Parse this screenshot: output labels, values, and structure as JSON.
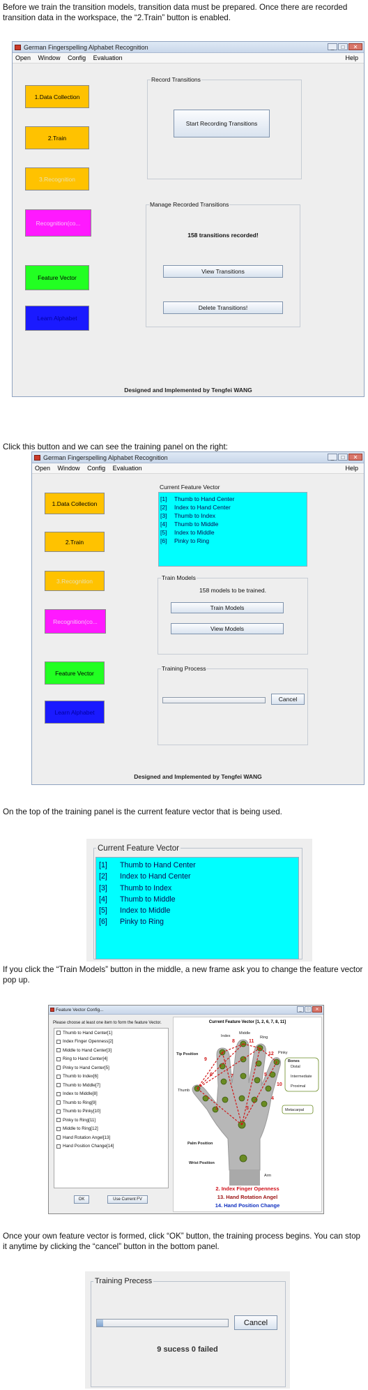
{
  "intro": {
    "text": "Before we train the transition models, transition data must be prepared. Once there are recorded transition data in the workspace, the “2.Train” button is enabled."
  },
  "app": {
    "title": "German Fingerspelling Alphabet Recognition",
    "menu": [
      "Open",
      "Window",
      "Config",
      "Evaluation"
    ],
    "help": "Help",
    "side_buttons": [
      "1.Data Collection",
      "2.Train",
      "3.Recognition",
      "Recognition(co...",
      "Feature Vector",
      "Learn Alphabet"
    ],
    "footer": "Designed and Implemented by Tengfei WANG"
  },
  "window1": {
    "record_title": "Record Transitions",
    "start_button": "Start Recording Transitions",
    "manage_title": "Manage Recorded Transitions",
    "count_text": "158  transitions recorded!",
    "view_button": "View Transitions",
    "delete_button": "Delete Transitions!"
  },
  "text2": "Click this button and we can see the training panel on the right:",
  "window2": {
    "fv_title": "Current Feature Vector",
    "fv_items": [
      {
        "n": "[1]",
        "label": "Thumb to Hand Center"
      },
      {
        "n": "[2]",
        "label": "Index to Hand Center"
      },
      {
        "n": "[3]",
        "label": "Thumb to Index"
      },
      {
        "n": "[4]",
        "label": "Thumb to Middle"
      },
      {
        "n": "[5]",
        "label": "Index to Middle"
      },
      {
        "n": "[6]",
        "label": "Pinky to Ring"
      }
    ],
    "train_title": "Train Models",
    "models_text": "158  models to be trained.",
    "train_button": "Train Models",
    "view_models_button": "View Models",
    "process_title": "Training Process",
    "cancel_button": "Cancel"
  },
  "text3": "On the top of the training panel is the current feature vector that is being used.",
  "zoom_fv": {
    "title": "Current Feature Vector"
  },
  "text4": "If you click the “Train Models” button in the middle, a new frame ask you to change the feature vector pop up.",
  "fv_frame": {
    "title": "Feature Vector Config...",
    "instruction": "Please choose at least one item to form the feature Vector.",
    "items": [
      "Thumb to Hand Center[1]",
      "Index Finger Openness[2]",
      "Middle to Hand Center[3]",
      "Ring to Hand Center[4]",
      "Pinky to Hand Center[5]",
      "Thumb to Index[6]",
      "Thumb to Middle[7]",
      "Index to Middle[8]",
      "Thumb to Ring[9]",
      "Thumb to Pinky[10]",
      "Pinky to Ring[11]",
      "Middle to Ring[12]",
      "Hand Rotation Angel[13]",
      "Hand Position Change[14]"
    ],
    "ok_button": "OK",
    "use_current_button": "Use Current FV",
    "right_header": "Current Feature Vector [1, 2, 6, 7, 8, 11]",
    "labels": {
      "index": "Index",
      "middle": "Middle",
      "ring": "Ring",
      "pinky": "Pinky",
      "tip": "Tip Position",
      "thumb": "Thumb",
      "bones": "Bones",
      "distal": "Distal",
      "intermediate": "Intermediate",
      "proximal": "Proximal",
      "metacarpal": "Metacarpal",
      "palm": "Palm Position",
      "wrist": "Wrist Position",
      "arm": "Arm"
    },
    "numbers": [
      "8",
      "11",
      "12",
      "9",
      "6",
      "7",
      "5",
      "1",
      "3",
      "10",
      "4"
    ],
    "notes": [
      {
        "text": "2. Index Finger Openness",
        "color": "#d0101a"
      },
      {
        "text": "13. Hand Rotation Angel",
        "color": "#9a1010"
      },
      {
        "text": "14. Hand Position Change",
        "color": "#1030c0"
      }
    ]
  },
  "text5": "Once your own feature vector is formed, click “OK” button, the training process begins. You can stop it anytime by clicking the “cancel” button in the bottom panel.",
  "zoom_process": {
    "title": "Training Precess",
    "cancel": "Cancel",
    "status": "9 sucess 0 failed",
    "progress": 0.05
  }
}
